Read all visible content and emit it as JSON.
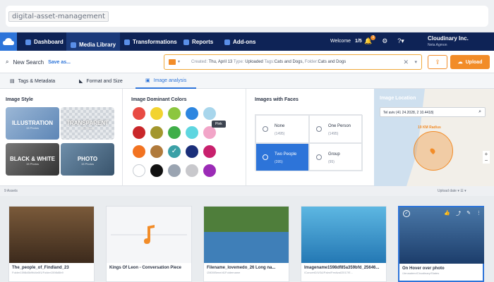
{
  "browser": {
    "tab_label": "digital-asset-management"
  },
  "nav": {
    "items": [
      "Dashboard",
      "Media Library",
      "Transformations",
      "Reports",
      "Add-ons"
    ],
    "welcome": "Welcome",
    "welcome_count": "1/5",
    "notif_count": "3",
    "account_name": "Cloudinary Inc.",
    "account_user": "Neta Agmon"
  },
  "search": {
    "new_search": "New Search",
    "save_as": "Save as...",
    "query_created_key": "Created:",
    "query_created_val": "Thu, April 13",
    "query_type_key": "Type:",
    "query_type_val": "Uploaded",
    "query_tags_key": "Tags:",
    "query_tags_val": "Cats and Dogs,",
    "query_folder_key": "Folder:",
    "query_folder_val": "Cats and Dogs",
    "upload_label": "Upload"
  },
  "subtabs": [
    "Tags & Metadata",
    "Format and Size",
    "Image analysis"
  ],
  "style": {
    "title": "Image Style",
    "tiles": [
      {
        "label": "ILLUSTRATION",
        "count": "15 Photos"
      },
      {
        "label": "TRANSPARENT",
        "count": "15 Photos"
      },
      {
        "label": "BLACK & WHITE",
        "count": "15 Photos"
      },
      {
        "label": "PHOTO",
        "count": "15 Photos"
      }
    ]
  },
  "colors": {
    "title": "Image Dominant Colors",
    "tooltip": "Pink",
    "swatches": [
      "#e84b43",
      "#f2d330",
      "#8cc63f",
      "#2d86e0",
      "#a8d6ec",
      "#c9272a",
      "#a3962d",
      "#3fae49",
      "#5ed6e0",
      "#f2a5c8",
      "#f27321",
      "#b07a3b",
      "#3aa0a6",
      "#1b2f7a",
      "#c8206d",
      "#ffffff",
      "#111111",
      "#9aa4b1",
      "#c8c8cc",
      "#9b2bb6"
    ]
  },
  "faces": {
    "title": "Images with Faces",
    "options": [
      {
        "label": "None",
        "count": "(1495)"
      },
      {
        "label": "One Person",
        "count": "(1495)"
      },
      {
        "label": "Two People",
        "count": "(395)"
      },
      {
        "label": "Group",
        "count": "(95)"
      }
    ]
  },
  "location": {
    "title": "Image Location",
    "query": "Tel aviv (41 24.2028, 2 10.4418)",
    "radius": "19 KM Radius"
  },
  "assets": {
    "count": "9 Assets",
    "sort": "Upload date",
    "cards": [
      {
        "title": "The_people_of_Findland_23",
        "path": "Folder1598d5b9fd4e0f1/Folder1598d5b9"
      },
      {
        "title": "Kings Of Leon - Conversation Piece",
        "path": ""
      },
      {
        "title": "Filename_lovemedo_26 Long na...",
        "path": "/2800/Bene/d1Foldername"
      },
      {
        "title": "Imagename1598df85a359bfd_25646...",
        "path": "/Concert2/USA/Palm/Festival/2017/E..."
      },
      {
        "title": "On Hover over photo",
        "path": "/Jerusalem/Cloudinary/States"
      }
    ]
  }
}
